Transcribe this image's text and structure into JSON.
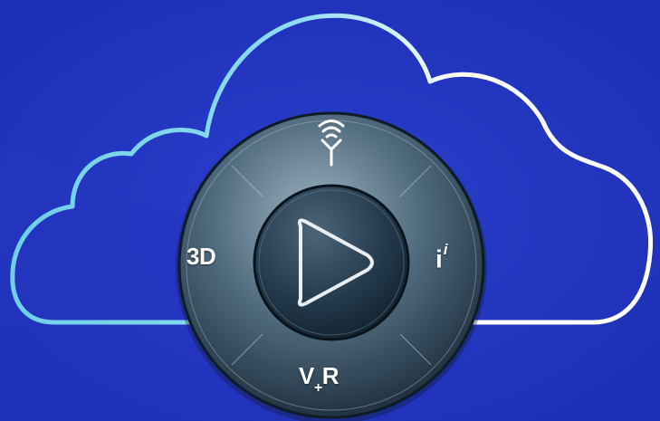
{
  "colors": {
    "background": "#1f30b8",
    "cloud_outline_left": "#6fd0e8",
    "cloud_outline_right": "#ffffff",
    "compass_ring": "#3f5a6e",
    "compass_center": "#1e3140"
  },
  "compass": {
    "left_quadrant": {
      "label": "3D"
    },
    "right_quadrant": {
      "label": "i",
      "superscript": "i"
    },
    "bottom_quadrant": {
      "label_v": "V",
      "label_plus": "+",
      "label_r": "R"
    },
    "top_quadrant": {
      "icon": "social-antenna-icon"
    },
    "center": {
      "icon": "play-icon"
    }
  }
}
